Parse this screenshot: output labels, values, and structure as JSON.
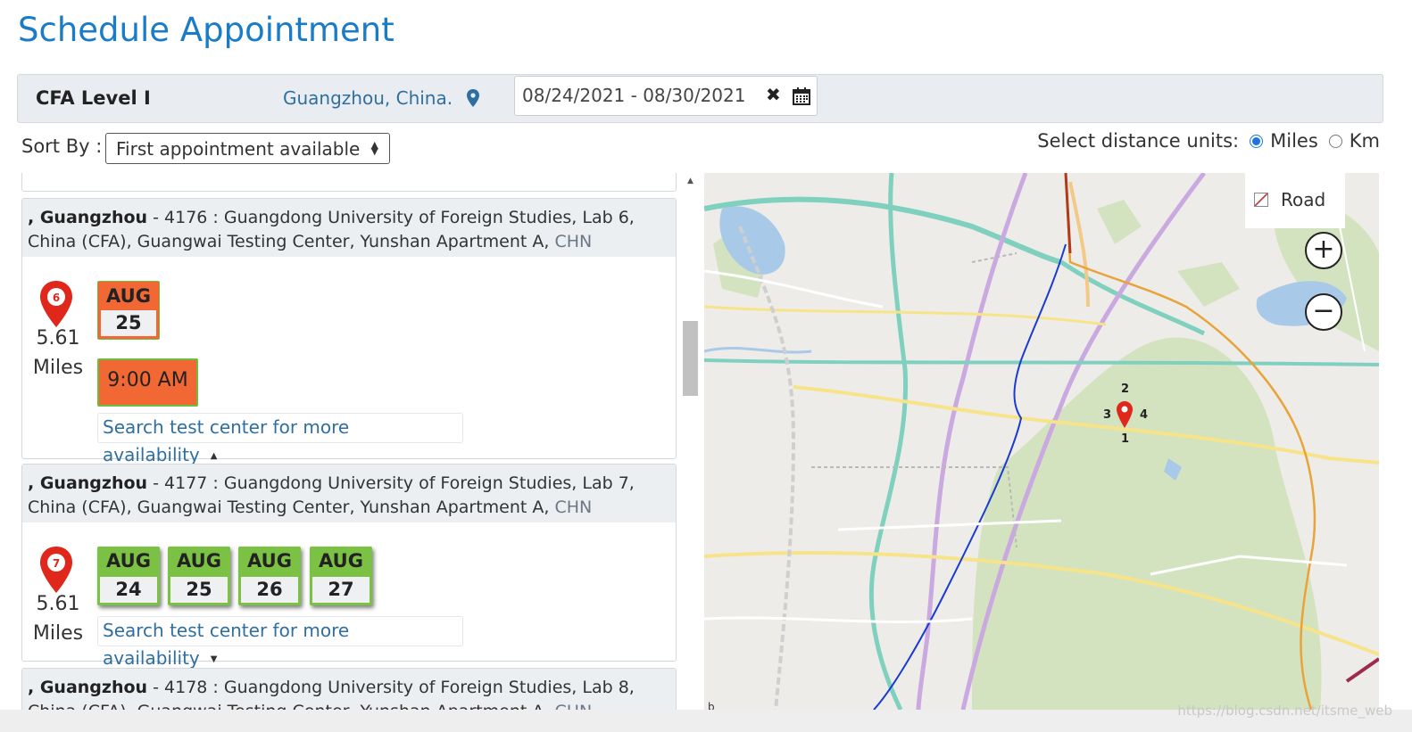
{
  "page": {
    "title": "Schedule Appointment"
  },
  "filters": {
    "exam": "CFA Level I",
    "location": "Guangzhou, China.",
    "date_range": "08/24/2021 - 08/30/2021",
    "clear_symbol": "✖"
  },
  "sort": {
    "label": "Sort By :",
    "selected": "First appointment available"
  },
  "units": {
    "label": "Select distance units:",
    "options": [
      "Miles",
      "Km"
    ],
    "selected": "Miles"
  },
  "results": [
    {
      "city": ", Guangzhou",
      "line1_rest": " - 4176 : Guangdong University of Foreign Studies, Lab 6,",
      "line2": "China (CFA), Guangwai Testing Center, Yunshan Apartment A, ",
      "country": "CHN",
      "marker": "6",
      "distance": "5.61",
      "unit": "Miles",
      "dates": [
        {
          "month": "AUG",
          "day": "25",
          "status": "selected"
        }
      ],
      "times": [
        "9:00 AM"
      ],
      "more_link": "Search test center for more availability",
      "more_expanded": true
    },
    {
      "city": ", Guangzhou",
      "line1_rest": " - 4177 : Guangdong University of Foreign Studies, Lab 7,",
      "line2": "China (CFA), Guangwai Testing Center, Yunshan Apartment A, ",
      "country": "CHN",
      "marker": "7",
      "distance": "5.61",
      "unit": "Miles",
      "dates": [
        {
          "month": "AUG",
          "day": "24",
          "status": "available"
        },
        {
          "month": "AUG",
          "day": "25",
          "status": "available"
        },
        {
          "month": "AUG",
          "day": "26",
          "status": "available"
        },
        {
          "month": "AUG",
          "day": "27",
          "status": "available"
        }
      ],
      "more_link": "Search test center for more availability",
      "more_expanded": false
    },
    {
      "city": ", Guangzhou",
      "line1_rest": " - 4178 : Guangdong University of Foreign Studies, Lab 8,",
      "line2": "China (CFA), Guangwai Testing Center, Yunshan Apartment A, ",
      "country": "CHN"
    }
  ],
  "map": {
    "style_label": "Road",
    "zoom_in": "+",
    "zoom_out": "−",
    "cluster_labels": [
      "2",
      "3",
      "4",
      "1"
    ],
    "logo_text": "b"
  },
  "colors": {
    "accent": "#1a7bc7",
    "selected": "#f26835",
    "available": "#7bc143",
    "marker": "#e0271c"
  },
  "icons": {
    "location": "map-pin-icon",
    "calendar": "calendar-icon",
    "clear": "close-icon",
    "select": "up-down-caret-icon"
  },
  "watermark": "https://blog.csdn.net/itsme_web"
}
